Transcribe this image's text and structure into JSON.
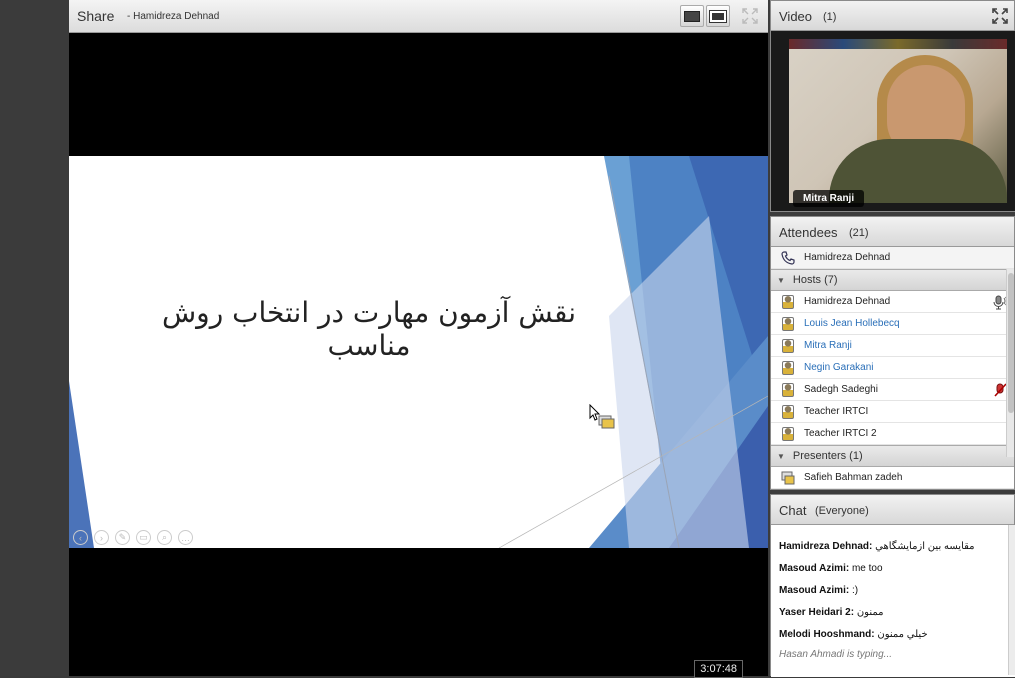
{
  "share": {
    "title": "Share",
    "presenter": "- Hamidreza Dehnad",
    "slide_title": "نقش آزمون مهارت در انتخاب روش مناسب",
    "timer": "3:07:48"
  },
  "video": {
    "title": "Video",
    "count": "(1)",
    "name": "Mitra Ranji"
  },
  "attendees": {
    "title": "Attendees",
    "count": "(21)",
    "phone_user": "Hamidreza Dehnad",
    "hosts_label": "Hosts (7)",
    "hosts": [
      {
        "name": "Hamidreza Dehnad"
      },
      {
        "name": "Louis Jean Hollebecq"
      },
      {
        "name": "Mitra Ranji"
      },
      {
        "name": "Negin Garakani"
      },
      {
        "name": "Sadegh Sadeghi"
      },
      {
        "name": "Teacher IRTCI"
      },
      {
        "name": "Teacher IRTCI 2"
      }
    ],
    "presenters_label": "Presenters (1)",
    "presenters": [
      {
        "name": "Safieh Bahman zadeh"
      }
    ]
  },
  "chat": {
    "title": "Chat",
    "scope": "(Everyone)",
    "messages": [
      {
        "sender": "Hamidreza Dehnad:",
        "text": "مقايسه بين ازمايشگاهي"
      },
      {
        "sender": "Masoud Azimi:",
        "text": "me too"
      },
      {
        "sender": "Masoud Azimi:",
        "text": ":)"
      },
      {
        "sender": "Yaser Heidari 2:",
        "text": "ممنون"
      },
      {
        "sender": "Melodi Hooshmand:",
        "text": "خيلي ممنون"
      }
    ],
    "typing": "Hasan Ahmadi is typing..."
  }
}
